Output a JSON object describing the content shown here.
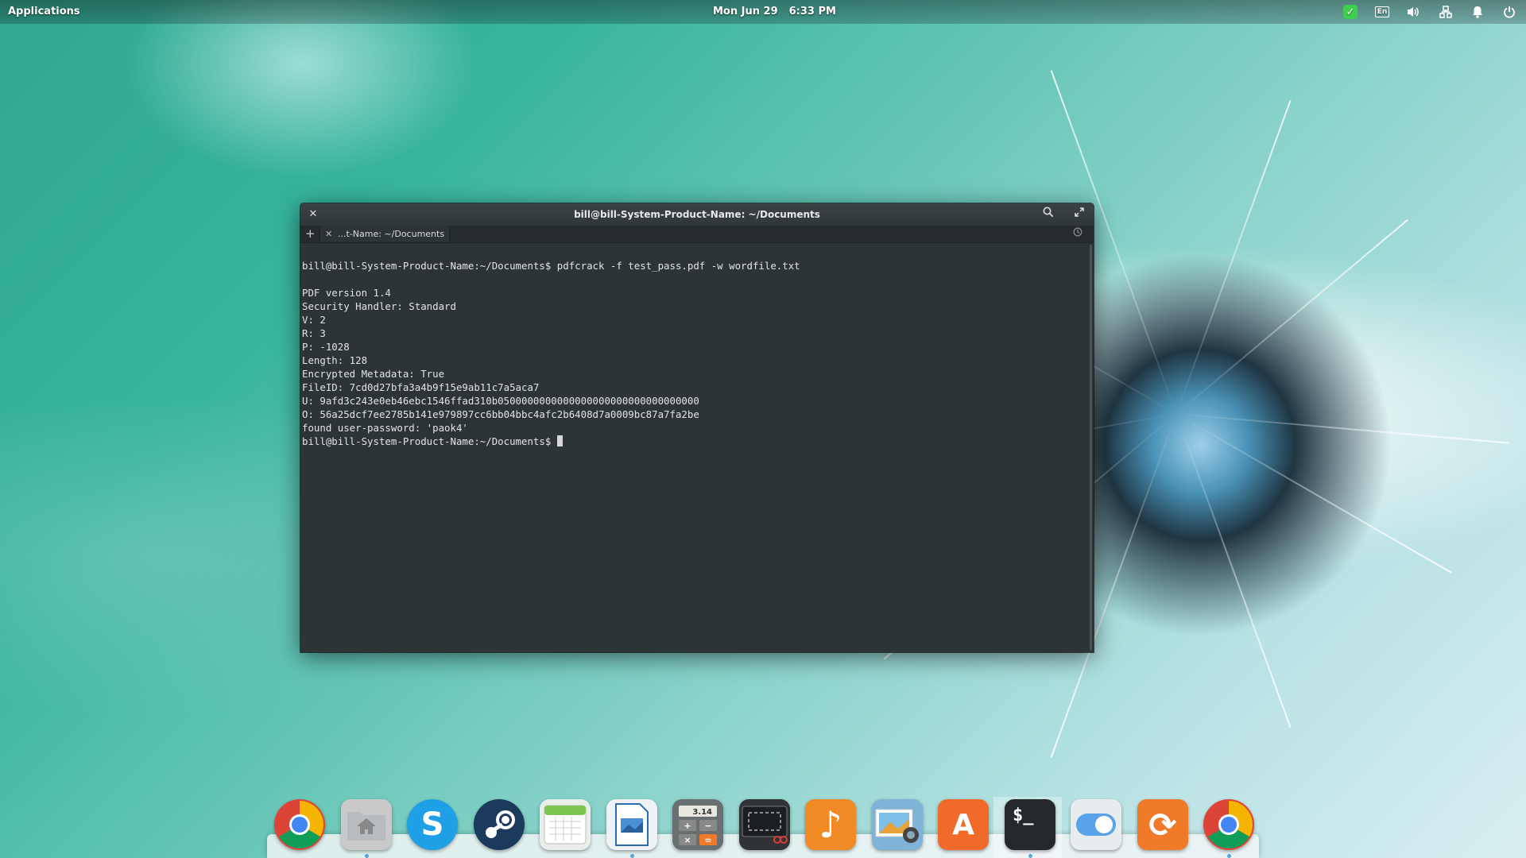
{
  "top_panel": {
    "applications_label": "Applications",
    "date": "Mon Jun 29",
    "time": "6:33 PM",
    "indicators": {
      "update_icon": "check-shield-icon",
      "keyboard_layout": "En",
      "sound_icon": "volume-icon",
      "network_icon": "network-icon",
      "notifications_icon": "bell-icon",
      "power_icon": "power-icon"
    }
  },
  "terminal": {
    "title": "bill@bill-System-Product-Name: ~/Documents",
    "tab_label": "...t-Name: ~/Documents",
    "background_color": "#2d3436",
    "lines": [
      "bill@bill-System-Product-Name:~/Documents$ pdfcrack -f test_pass.pdf -w wordfile.txt",
      "",
      "PDF version 1.4",
      "Security Handler: Standard",
      "V: 2",
      "R: 3",
      "P: -1028",
      "Length: 128",
      "Encrypted Metadata: True",
      "FileID: 7cd0d27bfa3a4b9f15e9ab11c7a5aca7",
      "U: 9afd3c243e0eb46ebc1546ffad310b0500000000000000000000000000000000",
      "O: 56a25dcf7ee2785b141e979897cc6bb04bbc4afc2b6408d7a0009bc87a7fa2be",
      "found user-password: 'paok4'"
    ],
    "prompt": "bill@bill-System-Product-Name:~/Documents$ "
  },
  "dock": {
    "items": [
      {
        "name": "chrome",
        "icon": "chrome-icon",
        "color": "#e0443a",
        "running": false
      },
      {
        "name": "files",
        "icon": "folder-home-icon",
        "color": "#c9c9c9",
        "running": true
      },
      {
        "name": "skype",
        "icon": "skype-icon",
        "color": "#1fa0e6",
        "running": false,
        "glyph": "S"
      },
      {
        "name": "steam",
        "icon": "steam-icon",
        "color": "#1b3a5c",
        "running": false
      },
      {
        "name": "calendar",
        "icon": "calendar-icon",
        "color": "#e9eeea",
        "running": false
      },
      {
        "name": "document-viewer",
        "icon": "document-image-icon",
        "color": "#eef2f6",
        "running": true
      },
      {
        "name": "calculator",
        "icon": "calculator-icon",
        "color": "#6a6f72",
        "running": false,
        "glyph": "3.14"
      },
      {
        "name": "screenshot",
        "icon": "screenshot-icon",
        "color": "#2f3336",
        "running": false
      },
      {
        "name": "music",
        "icon": "music-note-icon",
        "color": "#f08a24",
        "running": false,
        "glyph": "♪"
      },
      {
        "name": "photos",
        "icon": "photos-icon",
        "color": "#7fb3d8",
        "running": false
      },
      {
        "name": "app-center",
        "icon": "appcenter-bag-icon",
        "color": "#f06a2a",
        "running": false,
        "glyph": "A"
      },
      {
        "name": "terminal",
        "icon": "terminal-icon",
        "color": "#25292b",
        "running": true,
        "glyph": "$_"
      },
      {
        "name": "switchboard",
        "icon": "toggle-settings-icon",
        "color": "#e8ecef",
        "running": false
      },
      {
        "name": "updater",
        "icon": "sync-icon",
        "color": "#f07a2a",
        "running": false,
        "glyph": "⟳"
      },
      {
        "name": "chrome-2",
        "icon": "chrome-icon",
        "color": "#e0443a",
        "running": true
      }
    ]
  }
}
